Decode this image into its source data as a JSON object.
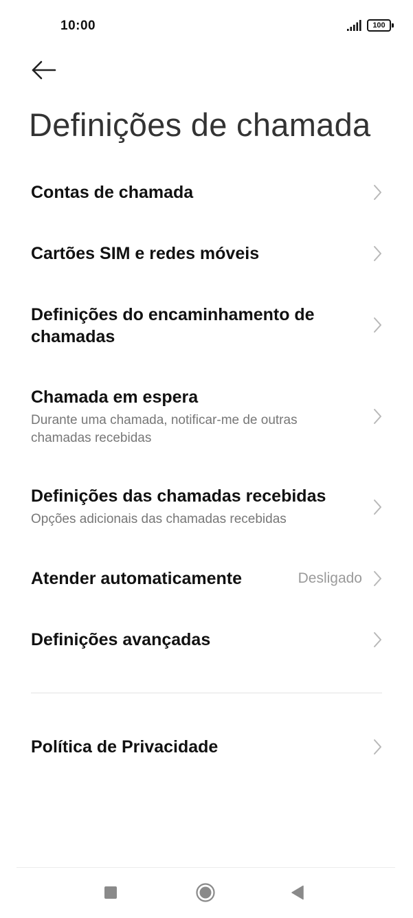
{
  "status_bar": {
    "time": "10:00",
    "battery": "100"
  },
  "header": {
    "back_icon": "arrow-left-icon",
    "title": "Definições de chamada"
  },
  "settings": {
    "items": [
      {
        "title": "Contas de chamada"
      },
      {
        "title": "Cartões SIM e redes móveis"
      },
      {
        "title": "Definições do encaminhamento de chamadas"
      },
      {
        "title": "Chamada em espera",
        "subtitle": "Durante uma chamada, notificar-me de outras chamadas recebidas"
      },
      {
        "title": "Definições das chamadas recebidas",
        "subtitle": "Opções adicionais das chamadas recebidas"
      },
      {
        "title": "Atender automaticamente",
        "value": "Desligado"
      },
      {
        "title": "Definições avançadas"
      }
    ],
    "privacy": {
      "title": "Política de Privacidade"
    }
  },
  "nav_bar": {
    "recents_icon": "square-icon",
    "home_icon": "circle-icon",
    "back_icon": "triangle-back-icon"
  },
  "colors": {
    "text_primary": "#111111",
    "text_secondary": "#777777",
    "value_text": "#9a9a9a",
    "chevron": "#b8b8b8",
    "nav_icon": "#8a8a8a"
  }
}
